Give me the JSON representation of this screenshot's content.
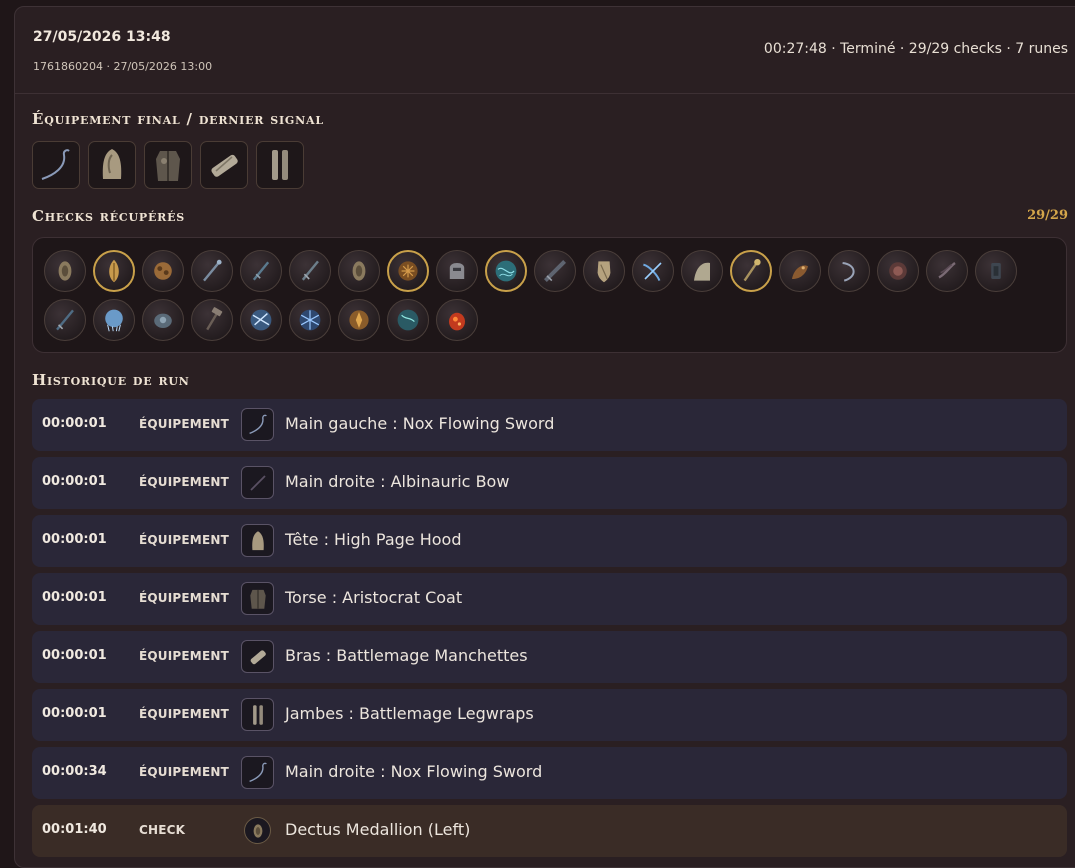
{
  "header": {
    "date": "27/05/2026 13:48",
    "sub": "1761860204 · 27/05/2026 13:00",
    "status": "00:27:48 · Terminé · 29/29 checks · 7 runes"
  },
  "equipment": {
    "title": "Équipement final / dernier signal",
    "slots": [
      {
        "icon": "whip-sword-icon"
      },
      {
        "icon": "hood-icon"
      },
      {
        "icon": "coat-icon"
      },
      {
        "icon": "manchettes-icon"
      },
      {
        "icon": "legwraps-icon"
      }
    ]
  },
  "checks": {
    "title": "Checks récupérés",
    "count": "29/29",
    "items": [
      {
        "icon": "medallion-icon",
        "gold": false
      },
      {
        "icon": "golden-seed-icon",
        "gold": true
      },
      {
        "icon": "ash-spirit-icon",
        "gold": false
      },
      {
        "icon": "staff-icon",
        "gold": false
      },
      {
        "icon": "dagger-icon",
        "gold": false
      },
      {
        "icon": "sword-icon",
        "gold": false
      },
      {
        "icon": "medallion-icon",
        "gold": false
      },
      {
        "icon": "great-rune-icon",
        "gold": true
      },
      {
        "icon": "helm-icon",
        "gold": false
      },
      {
        "icon": "glintstone-icon",
        "gold": true
      },
      {
        "icon": "greatsword-icon",
        "gold": false
      },
      {
        "icon": "shield-icon",
        "gold": false
      },
      {
        "icon": "crossbow-icon",
        "gold": false
      },
      {
        "icon": "cloak-icon",
        "gold": false
      },
      {
        "icon": "sceptre-icon",
        "gold": true
      },
      {
        "icon": "beast-icon",
        "gold": false
      },
      {
        "icon": "whip-icon",
        "gold": false
      },
      {
        "icon": "remembrance-icon",
        "gold": false
      },
      {
        "icon": "claw-icon",
        "gold": false
      },
      {
        "icon": "tablet-icon",
        "gold": false
      },
      {
        "icon": "katana-icon",
        "gold": false
      },
      {
        "icon": "spirit-jellyfish-icon",
        "gold": false
      },
      {
        "icon": "pouch-icon",
        "gold": false
      },
      {
        "icon": "hammer-icon",
        "gold": false
      },
      {
        "icon": "lightning-spell-icon",
        "gold": false
      },
      {
        "icon": "frost-spell-icon",
        "gold": false
      },
      {
        "icon": "golden-rune-icon",
        "gold": false
      },
      {
        "icon": "ice-spell-icon",
        "gold": false
      },
      {
        "icon": "fire-flask-icon",
        "gold": false
      }
    ]
  },
  "history": {
    "title": "Historique de run",
    "rows": [
      {
        "time": "00:00:01",
        "type": "ÉQUIPEMENT",
        "label": "Main gauche : Nox Flowing Sword",
        "icon": "whip-sword-icon",
        "kind": "equip"
      },
      {
        "time": "00:00:01",
        "type": "ÉQUIPEMENT",
        "label": "Main droite : Albinauric Bow",
        "icon": "bow-icon",
        "kind": "equip"
      },
      {
        "time": "00:00:01",
        "type": "ÉQUIPEMENT",
        "label": "Tête : High Page Hood",
        "icon": "hood-icon",
        "kind": "equip"
      },
      {
        "time": "00:00:01",
        "type": "ÉQUIPEMENT",
        "label": "Torse : Aristocrat Coat",
        "icon": "coat-icon",
        "kind": "equip"
      },
      {
        "time": "00:00:01",
        "type": "ÉQUIPEMENT",
        "label": "Bras : Battlemage Manchettes",
        "icon": "manchettes-icon",
        "kind": "equip"
      },
      {
        "time": "00:00:01",
        "type": "ÉQUIPEMENT",
        "label": "Jambes : Battlemage Legwraps",
        "icon": "legwraps-icon",
        "kind": "equip"
      },
      {
        "time": "00:00:34",
        "type": "ÉQUIPEMENT",
        "label": "Main droite : Nox Flowing Sword",
        "icon": "whip-sword-icon",
        "kind": "equip"
      },
      {
        "time": "00:01:40",
        "type": "CHECK",
        "label": "Dectus Medallion (Left)",
        "icon": "medallion-icon",
        "kind": "check"
      }
    ]
  }
}
